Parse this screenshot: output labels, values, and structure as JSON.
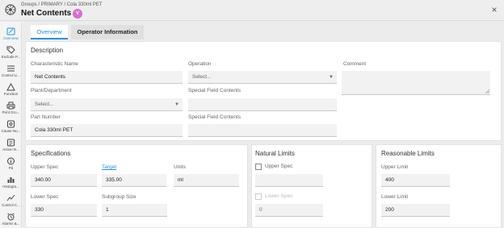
{
  "header": {
    "breadcrumb": "Groups / PRIMARY / Cola 330ml PET",
    "title": "Net Contents",
    "badge": "V",
    "close_glyph": "×"
  },
  "sidebar": {
    "items": [
      {
        "label": "Overview",
        "icon": "overview-icon",
        "active": true
      },
      {
        "label": "Exclude P...",
        "icon": "tag-icon"
      },
      {
        "label": "Control Li...",
        "icon": "control-limits-icon"
      },
      {
        "label": "Function",
        "icon": "function-icon"
      },
      {
        "label": "Print Gro...",
        "icon": "printer-icon"
      },
      {
        "label": "Cause No...",
        "icon": "cause-icon"
      },
      {
        "label": "Action N...",
        "icon": "action-icon"
      },
      {
        "label": "Pd",
        "icon": "info-icon"
      },
      {
        "label": "Histogra...",
        "icon": "histogram-icon"
      },
      {
        "label": "Control C...",
        "icon": "control-chart-icon"
      },
      {
        "label": "Alarms &...",
        "icon": "alarm-icon"
      }
    ]
  },
  "tabs": [
    {
      "label": "Overview",
      "active": true
    },
    {
      "label": "Operator Information",
      "active": false
    }
  ],
  "description": {
    "title": "Description",
    "characteristic_name_label": "Characteristic Name",
    "characteristic_name_value": "Net Contents",
    "operation_label": "Operation",
    "operation_value": "Select...",
    "comment_label": "Comment",
    "plant_label": "Plant/Department",
    "plant_value": "Select...",
    "special1_label": "Special Field Contents",
    "special2_label": "Special Field Contents",
    "part_label": "Part Number",
    "part_value": "Cola 330ml PET"
  },
  "specifications": {
    "title": "Specifications",
    "upper_label": "Upper Spec",
    "upper_value": "340.00",
    "target_label": "Target",
    "target_value": "335.00",
    "units_label": "Units",
    "units_value": "ml",
    "lower_label": "Lower Spec",
    "lower_value": "330",
    "subgroup_label": "Subgroup Size",
    "subgroup_value": "1"
  },
  "natural_limits": {
    "title": "Natural Limits",
    "upper_label": "Upper Spec",
    "lower_label": "Lower Spec",
    "lower_value": "0"
  },
  "reasonable_limits": {
    "title": "Reasonable Limits",
    "upper_label": "Upper Limit",
    "upper_value": "400",
    "lower_label": "Lower Limit",
    "lower_value": "200"
  },
  "colors": {
    "accent": "#2a8fd8",
    "badge": "#d96bd6"
  }
}
